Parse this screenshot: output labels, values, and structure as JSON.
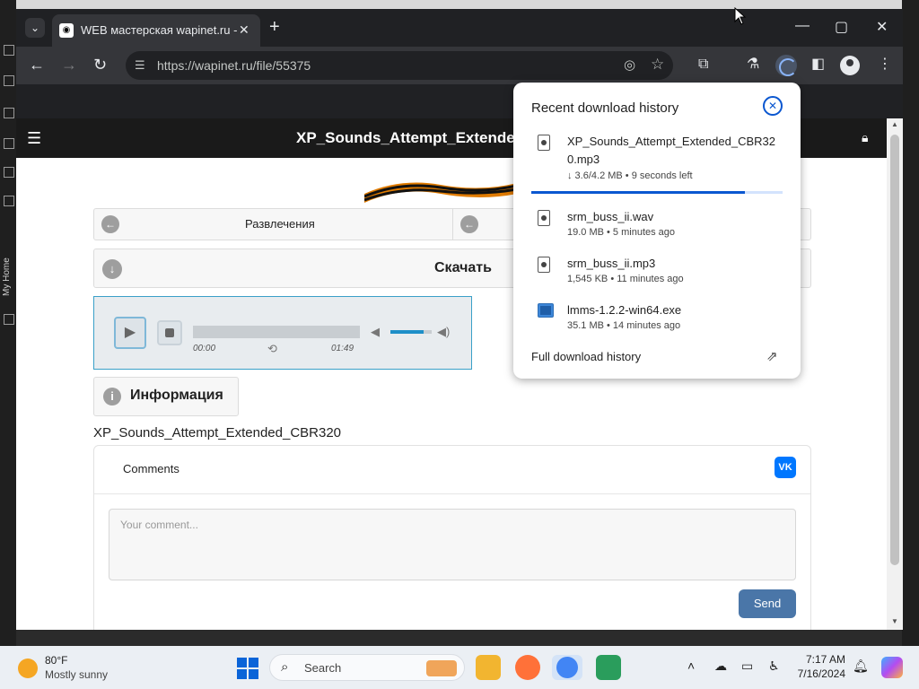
{
  "browser": {
    "tab_title": "WEB мастерская wapinet.ru -",
    "url": "https://wapinet.ru/file/55375"
  },
  "page": {
    "header_title": "XP_Sounds_Attempt_Extended_",
    "nav_left": "Развлечения",
    "download_label": "Скачать",
    "player": {
      "current_time": "00:00",
      "duration": "01:49",
      "volume_fraction": 0.8,
      "accent": "#1e8fc8"
    },
    "info_label": "Информация",
    "file_name": "XP_Sounds_Attempt_Extended_CBR320",
    "comments": {
      "header": "Comments",
      "vk_label": "VK",
      "placeholder": "Your comment...",
      "send_label": "Send"
    }
  },
  "downloads": {
    "title": "Recent download history",
    "items": [
      {
        "name": "XP_Sounds_Attempt_Extended_CBR320.mp3",
        "meta": "↓ 3.6/4.2 MB • 9 seconds left",
        "progress": 0.85,
        "icon": "audio-file-icon"
      },
      {
        "name": "srm_buss_ii.wav",
        "meta": "19.0 MB • 5 minutes ago",
        "icon": "audio-file-icon"
      },
      {
        "name": "srm_buss_ii.mp3",
        "meta": "1,545 KB • 11 minutes ago",
        "icon": "audio-file-icon"
      },
      {
        "name": "lmms-1.2.2-win64.exe",
        "meta": "35.1 MB • 14 minutes ago",
        "icon": "exe-file-icon"
      }
    ],
    "full_history_label": "Full download history",
    "accent": "#0b57d0"
  },
  "taskbar": {
    "temperature": "80°F",
    "condition": "Mostly sunny",
    "search_label": "Search",
    "time": "7:17 AM",
    "date": "7/16/2024"
  },
  "desktop": {
    "sidebar_label": "My Home"
  }
}
